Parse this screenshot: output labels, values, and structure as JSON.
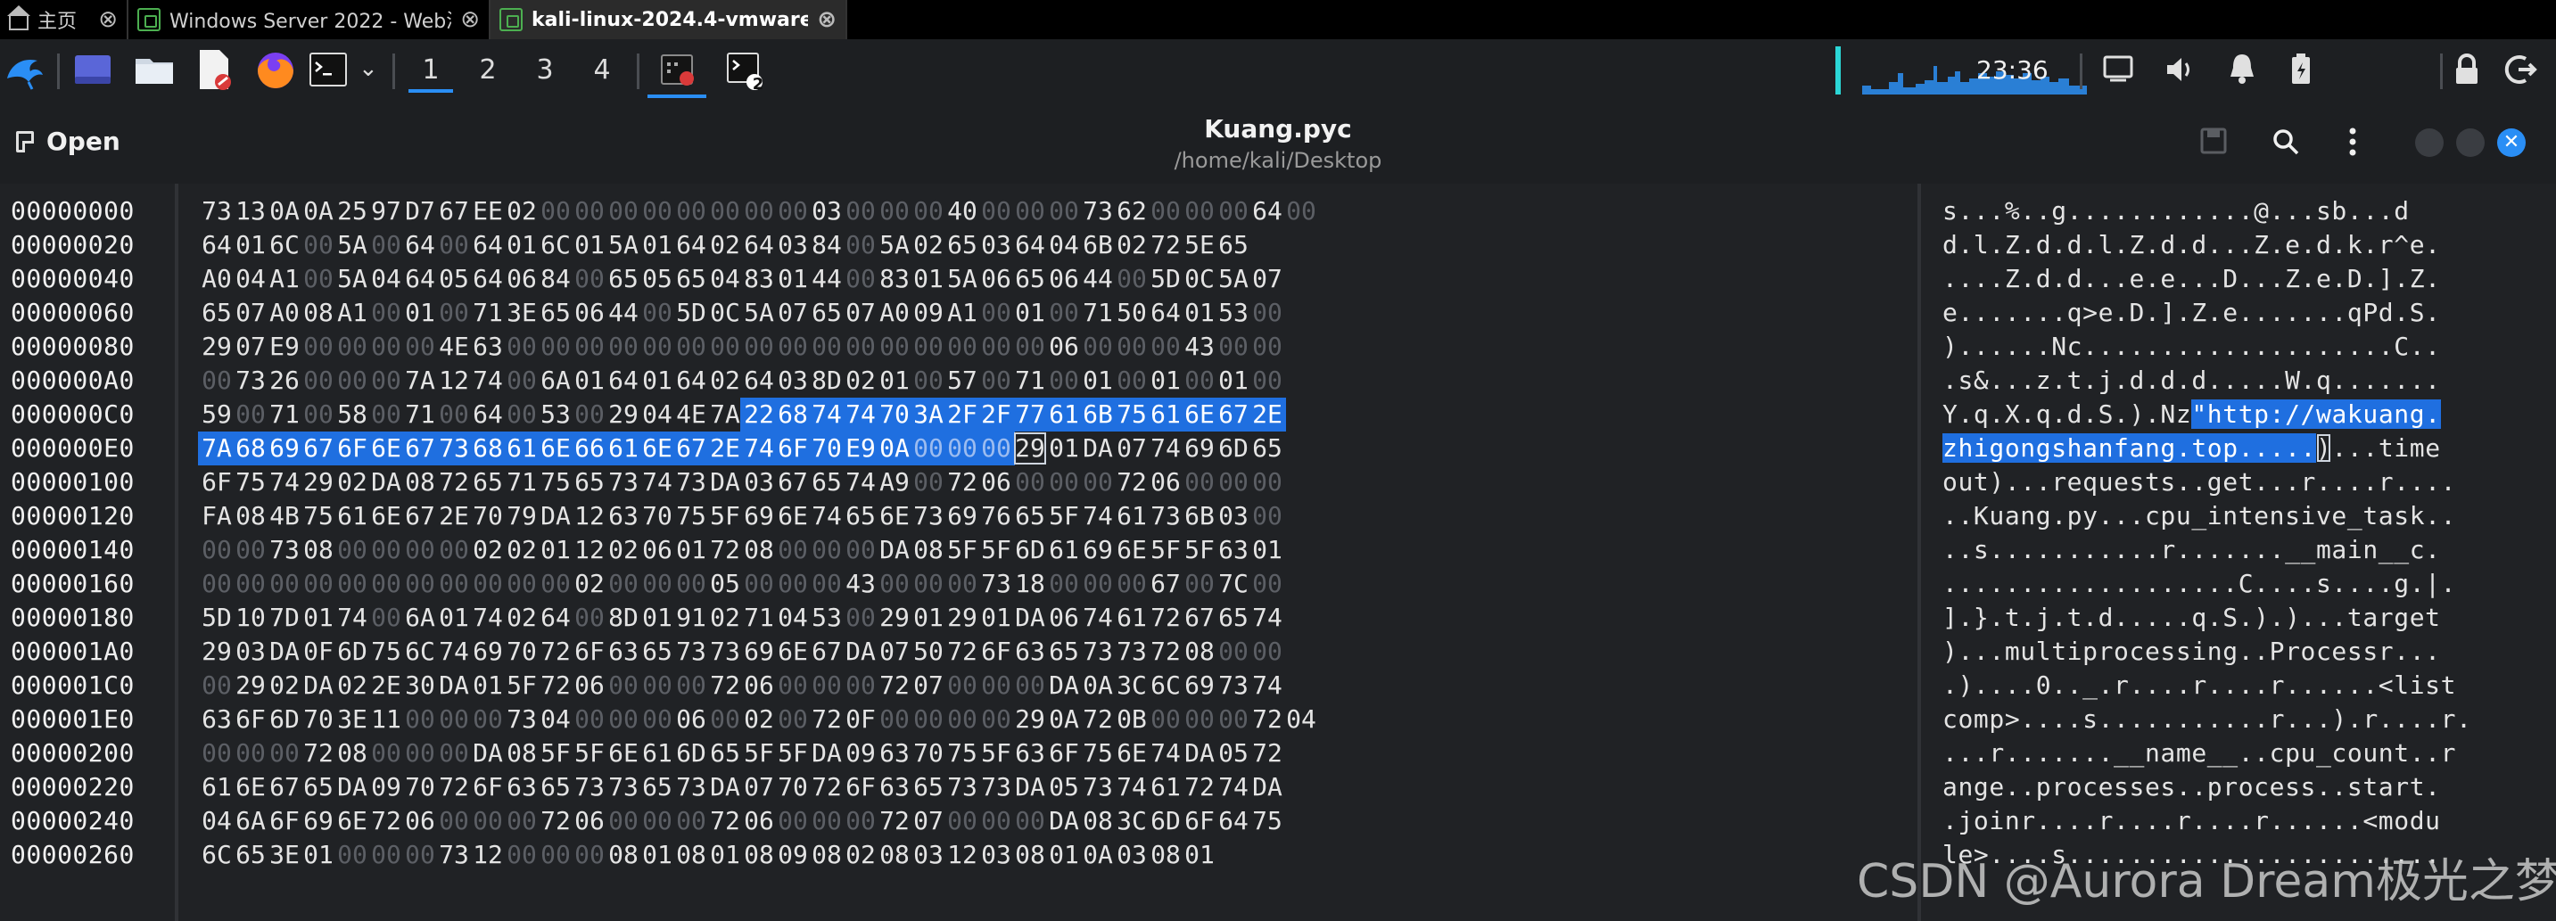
{
  "vm_tabs": [
    {
      "label": "主页"
    },
    {
      "label": "Windows Server 2022 - Web渗..."
    },
    {
      "label": "kali-linux-2024.4-vmware-..."
    }
  ],
  "panel": {
    "workspaces": [
      "1",
      "2",
      "3",
      "4"
    ],
    "active_workspace": "1",
    "terminal_badge": "2",
    "clock": "23:36"
  },
  "editor": {
    "open_label": "Open",
    "title": "Kuang.pyc",
    "subtitle": "/home/kali/Desktop"
  },
  "hex": {
    "offsets": [
      "00000000",
      "00000020",
      "00000040",
      "00000060",
      "00000080",
      "000000A0",
      "000000C0",
      "000000E0",
      "00000100",
      "00000120",
      "00000140",
      "00000160",
      "00000180",
      "000001A0",
      "000001C0",
      "000001E0",
      "00000200",
      "00000220",
      "00000240",
      "00000260"
    ],
    "rows": [
      "73 13 0A 0A 25 97 D7 67 EE 02 00 00 00 00 00 00 00 00 03 00 00 00 40 00 00 00 73 62 00 00 00 64 00",
      "64 01 6C 00 5A 00 64 00 64 01 6C 01 5A 01 64 02 64 03 84 00 5A 02 65 03 64 04 6B 02 72 5E 65",
      "A0 04 A1 00 5A 04 64 05 64 06 84 00 65 05 65 04 83 01 44 00 83 01 5A 06 65 06 44 00 5D 0C 5A 07",
      "65 07 A0 08 A1 00 01 00 71 3E 65 06 44 00 5D 0C 5A 07 65 07 A0 09 A1 00 01 00 71 50 64 01 53 00",
      "29 07 E9 00 00 00 00 4E 63 00 00 00 00 00 00 00 00 00 00 00 00 00 00 00 00 06 00 00 00 43 00 00",
      "00 73 26 00 00 00 7A 12 74 00 6A 01 64 01 64 02 64 03 8D 02 01 00 57 00 71 00 01 00 01 00 01 00",
      "59 00 71 00 58 00 71 00 64 00 53 00 29 04 4E 7A 22 68 74 74 70 3A 2F 2F 77 61 6B 75 61 6E 67 2E",
      "7A 68 69 67 6F 6E 67 73 68 61 6E 66 61 6E 67 2E 74 6F 70 E9 0A 00 00 00 29 01 DA 07 74 69 6D 65",
      "6F 75 74 29 02 DA 08 72 65 71 75 65 73 74 73 DA 03 67 65 74 A9 00 72 06 00 00 00 72 06 00 00 00",
      "FA 08 4B 75 61 6E 67 2E 70 79 DA 12 63 70 75 5F 69 6E 74 65 6E 73 69 76 65 5F 74 61 73 6B 03 00",
      "00 00 73 08 00 00 00 00 02 02 01 12 02 06 01 72 08 00 00 00 DA 08 5F 5F 6D 61 69 6E 5F 5F 63 01",
      "00 00 00 00 00 00 00 00 00 00 00 02 00 00 00 05 00 00 00 43 00 00 00 73 18 00 00 00 67 00 7C 00",
      "5D 10 7D 01 74 00 6A 01 74 02 64 00 8D 01 91 02 71 04 53 00 29 01 29 01 DA 06 74 61 72 67 65 74",
      "29 03 DA 0F 6D 75 6C 74 69 70 72 6F 63 65 73 73 69 6E 67 DA 07 50 72 6F 63 65 73 73 72 08 00 00",
      "00 29 02 DA 02 2E 30 DA 01 5F 72 06 00 00 00 72 06 00 00 00 72 07 00 00 00 DA 0A 3C 6C 69 73 74",
      "63 6F 6D 70 3E 11 00 00 00 73 04 00 00 00 06 00 02 00 72 0F 00 00 00 00 29 0A 72 0B 00 00 00 72 04",
      "00 00 00 72 08 00 00 00 DA 08 5F 5F 6E 61 6D 65 5F 5F DA 09 63 70 75 5F 63 6F 75 6E 74 DA 05 72",
      "61 6E 67 65 DA 09 70 72 6F 63 65 73 73 65 73 DA 07 70 72 6F 63 65 73 73 DA 05 73 74 61 72 74 DA",
      "04 6A 6F 69 6E 72 06 00 00 00 72 06 00 00 00 72 06 00 00 00 72 07 00 00 00 DA 08 3C 6D 6F 64 75",
      "6C 65 3E 01 00 00 00 73 12 00 00 00 08 01 08 01 08 09 08 02 08 03 12 03 08 01 0A 03 08 01"
    ],
    "ascii": [
      "s...%..g............@...sb...d",
      "d.l.Z.d.d.l.Z.d.d...Z.e.d.k.r^e.",
      "....Z.d.d...e.e...D...Z.e.D.].Z.",
      "e.......q>e.D.].Z.e.......qPd.S.",
      ")......Nc....................C..",
      ".s&...z.t.j.d.d.d.....W.q.......",
      "Y.q.X.q.d.S.).Nz\"http://wakuang.",
      "zhigongshanfang.top.....)...time",
      "out)...requests..get...r....r....",
      "..Kuang.py...cpu_intensive_task..",
      "..s...........r.......__main__c.",
      "...................C....s....g.|.",
      "].}.t.j.t.d.....q.S.).)...target",
      ")...multiprocessing..Processr...",
      ".)....0.._.r....r....r......<list",
      "comp>....s...........r...).r....r.",
      "...r.......__name__..cpu_count..r",
      "ange..processes..process..start.",
      ".joinr....r....r....r......<modu",
      "le>....s........................"
    ]
  },
  "watermark": "CSDN @Aurora Dream极光之梦",
  "colors": {
    "selection": "#1f6fe0",
    "background": "#202225",
    "zero_byte": "#5c5f65"
  }
}
